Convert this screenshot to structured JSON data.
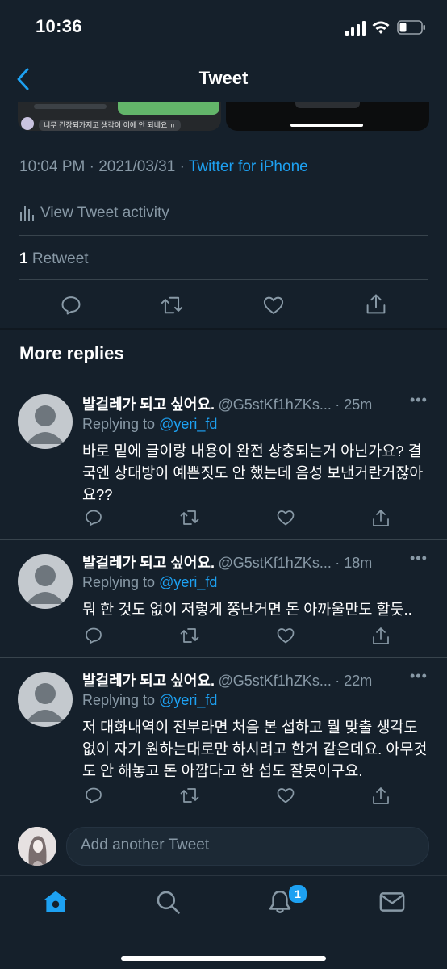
{
  "status_bar": {
    "time": "10:36"
  },
  "header": {
    "title": "Tweet"
  },
  "media": {
    "left_caption": "너무 긴장되가지고 생각이 이에 안 되네요 ㅠ"
  },
  "tweet_meta": {
    "time": "10:04 PM",
    "separator": " · ",
    "date": "2021/03/31",
    "separator2": " · ",
    "source": "Twitter for iPhone"
  },
  "activity": {
    "label": "View Tweet activity"
  },
  "stats": {
    "retweet_count": "1",
    "retweet_label": "Retweet"
  },
  "more_replies": {
    "title": "More replies"
  },
  "replies": [
    {
      "name": "발걸레가 되고 싶어요.",
      "handle": "@G5stKf1hZKs...",
      "time": "· 25m",
      "replying_prefix": "Replying to ",
      "replying_to": "@yeri_fd",
      "text": "바로 밑에 글이랑 내용이 완전 상충되는거 아닌가요? 결국엔 상대방이 예쁜짓도 안 했는데 음성 보낸거란거잖아요??"
    },
    {
      "name": "발걸레가 되고 싶어요.",
      "handle": "@G5stKf1hZKs...",
      "time": "· 18m",
      "replying_prefix": "Replying to ",
      "replying_to": "@yeri_fd",
      "text": "뭐 한 것도 없이 저렇게 쫑난거면 돈 아까울만도 할듯.."
    },
    {
      "name": "발걸레가 되고 싶어요.",
      "handle": "@G5stKf1hZKs...",
      "time": "· 22m",
      "replying_prefix": "Replying to ",
      "replying_to": "@yeri_fd",
      "text": "저 대화내역이 전부라면 처음 본 섭하고 뭘 맞출 생각도 없이 자기 원하는대로만 하시려고 한거 같은데요.  아무것도 안 해놓고 돈 아깝다고 한 섭도 잘못이구요."
    }
  ],
  "composer": {
    "placeholder": "Add another Tweet"
  },
  "tabbar": {
    "notifications_badge": "1"
  },
  "colors": {
    "background": "#15202b",
    "accent": "#1da1f2",
    "muted": "#8899a6",
    "divider": "#38444d"
  },
  "icons": [
    "back-chevron-icon",
    "stats-icon",
    "reply-icon",
    "retweet-icon",
    "like-icon",
    "share-icon",
    "more-icon",
    "home-icon",
    "search-icon",
    "bell-icon",
    "mail-icon",
    "signal-icon",
    "wifi-icon",
    "battery-icon"
  ]
}
